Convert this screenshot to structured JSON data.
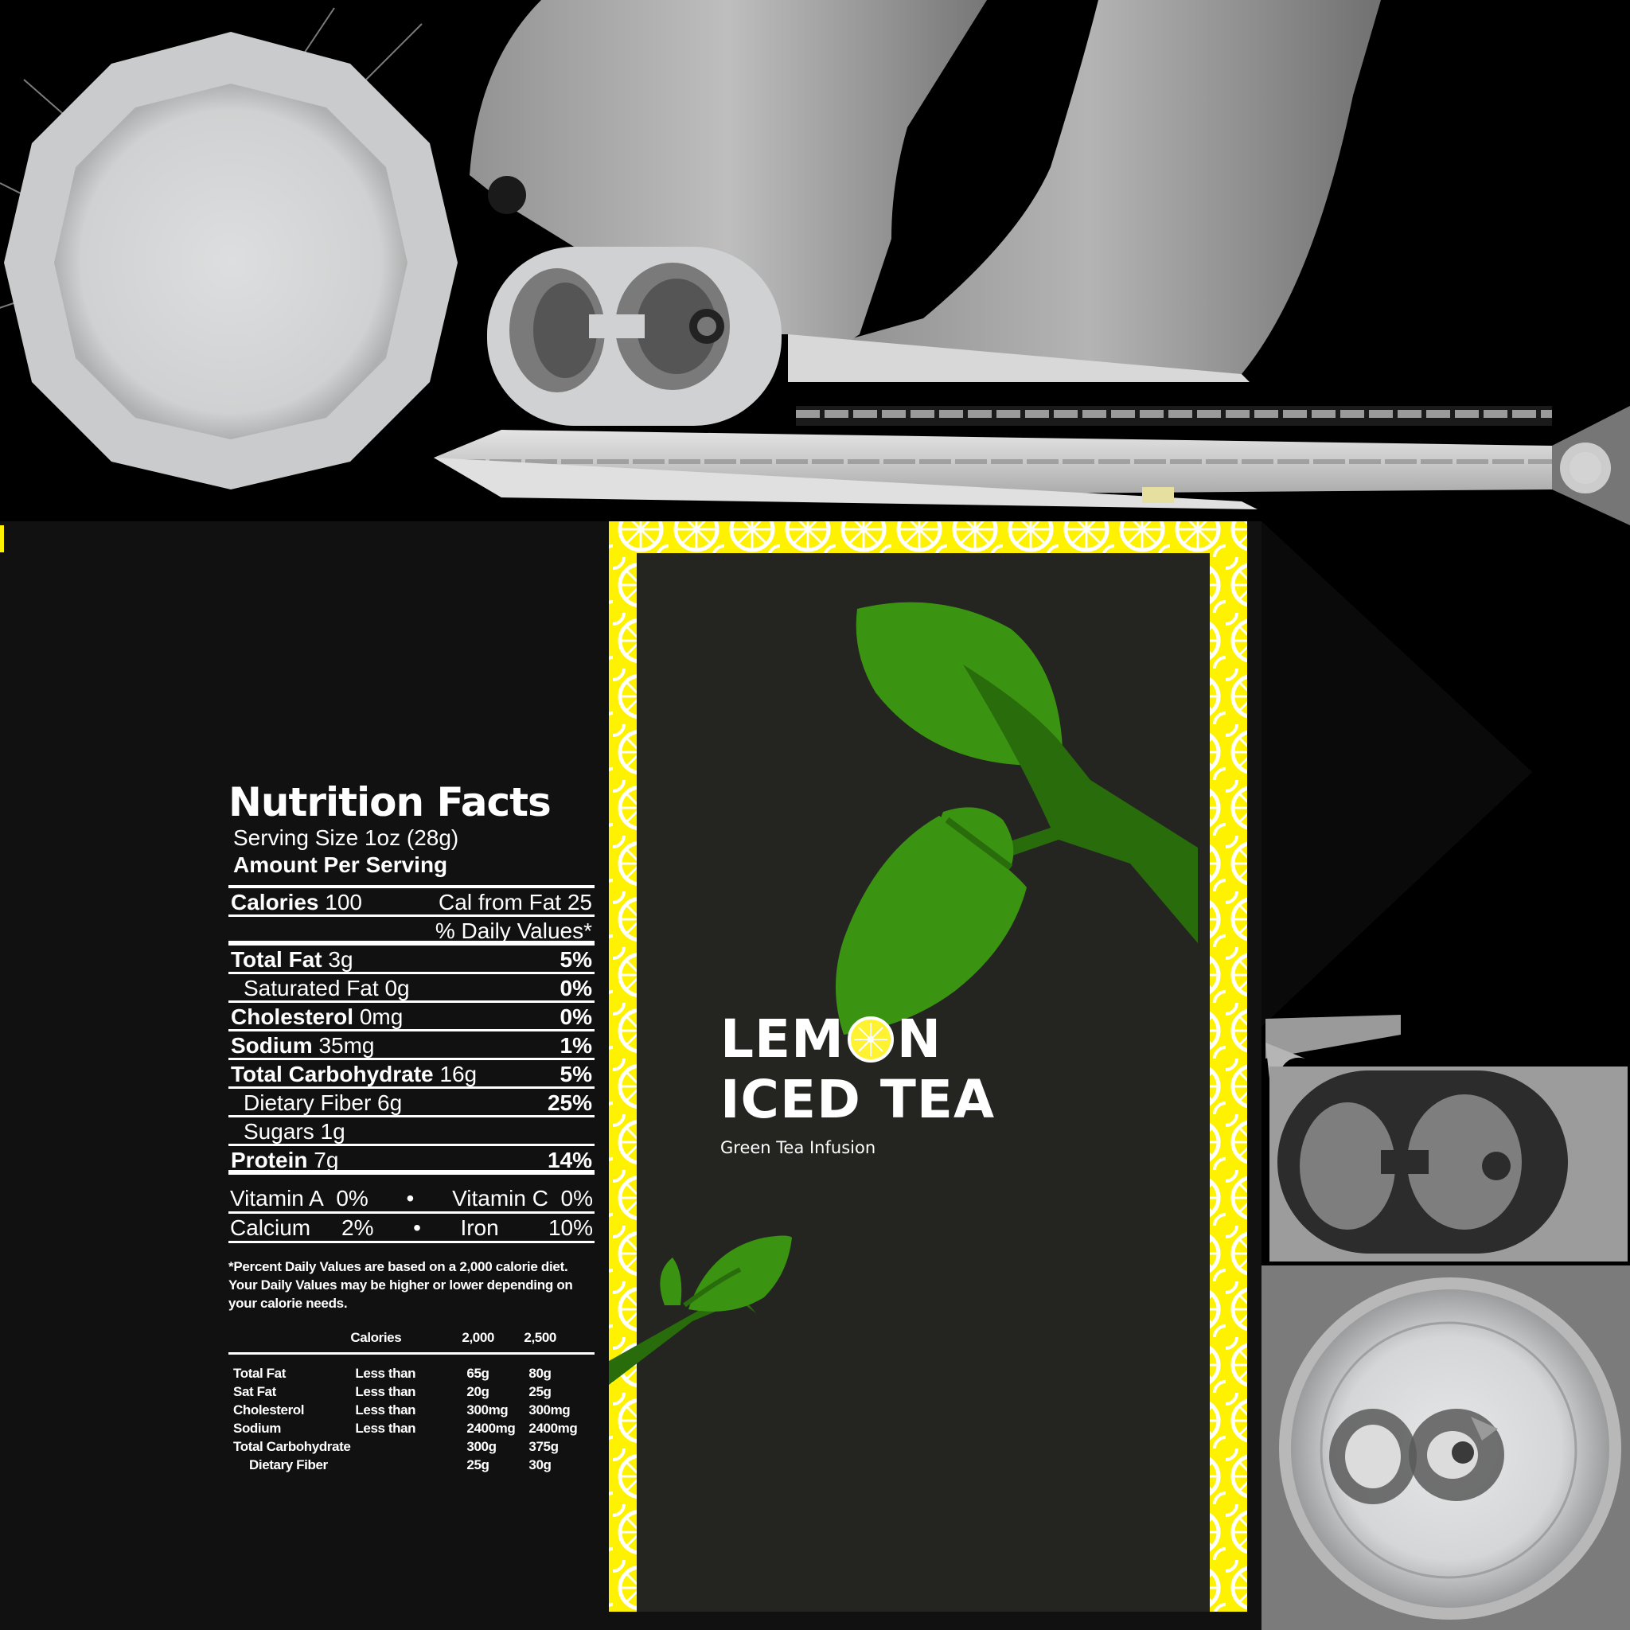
{
  "colors": {
    "background": "#000000",
    "panel": "#111111",
    "label_bg": "#242520",
    "lemon_yellow": "#fff200",
    "leaf_green": "#3a9412",
    "leaf_dark": "#286c0c",
    "metal": "#c8cacb"
  },
  "nutrition": {
    "title": "Nutrition Facts",
    "serving_size": "Serving Size 1oz (28g)",
    "amount_per_serving": "Amount Per Serving",
    "calories_label": "Calories",
    "calories_value": "100",
    "cal_from_fat": "Cal from Fat 25",
    "daily_values_header": "% Daily Values*",
    "rows": [
      {
        "label": "Total Fat",
        "amount": "3g",
        "dv": "5%"
      },
      {
        "label": "Saturated Fat",
        "amount": "0g",
        "dv": "0%"
      },
      {
        "label": "Cholesterol",
        "amount": "0mg",
        "dv": "0%"
      },
      {
        "label": "Sodium",
        "amount": "35mg",
        "dv": "1%"
      },
      {
        "label": "Total Carbohydrate",
        "amount": "16g",
        "dv": "5%"
      },
      {
        "label": "Dietary Fiber",
        "amount": "6g",
        "dv": "25%"
      },
      {
        "label": "Sugars",
        "amount": "1g",
        "dv": ""
      },
      {
        "label": "Protein",
        "amount": "7g",
        "dv": "14%"
      }
    ],
    "vitamins": [
      {
        "name": "Vitamin A",
        "value": "0%"
      },
      {
        "name": "Vitamin C",
        "value": "0%"
      },
      {
        "name": "Calcium",
        "value": "2%"
      },
      {
        "name": "Iron",
        "value": "10%"
      }
    ],
    "separator": "•",
    "footnote": "*Percent Daily Values are based on a 2,000 calorie diet. Your Daily Values may be higher or lower depending on your calorie needs.",
    "table": {
      "headers": [
        "",
        "Calories",
        "2,000",
        "2,500"
      ],
      "rows": [
        [
          "Total Fat",
          "Less than",
          "65g",
          "80g"
        ],
        [
          "Sat Fat",
          "Less than",
          "20g",
          "25g"
        ],
        [
          "Cholesterol",
          "Less than",
          "300mg",
          "300mg"
        ],
        [
          "Sodium",
          "Less than",
          "2400mg",
          "2400mg"
        ],
        [
          "Total Carbohydrate",
          "",
          "300g",
          "375g"
        ],
        [
          "Dietary Fiber",
          "",
          "25g",
          "30g"
        ]
      ]
    }
  },
  "label": {
    "brand_line1_a": "LEM",
    "brand_line1_b": "N",
    "brand_line2": "ICED TEA",
    "subtitle": "Green Tea Infusion"
  }
}
